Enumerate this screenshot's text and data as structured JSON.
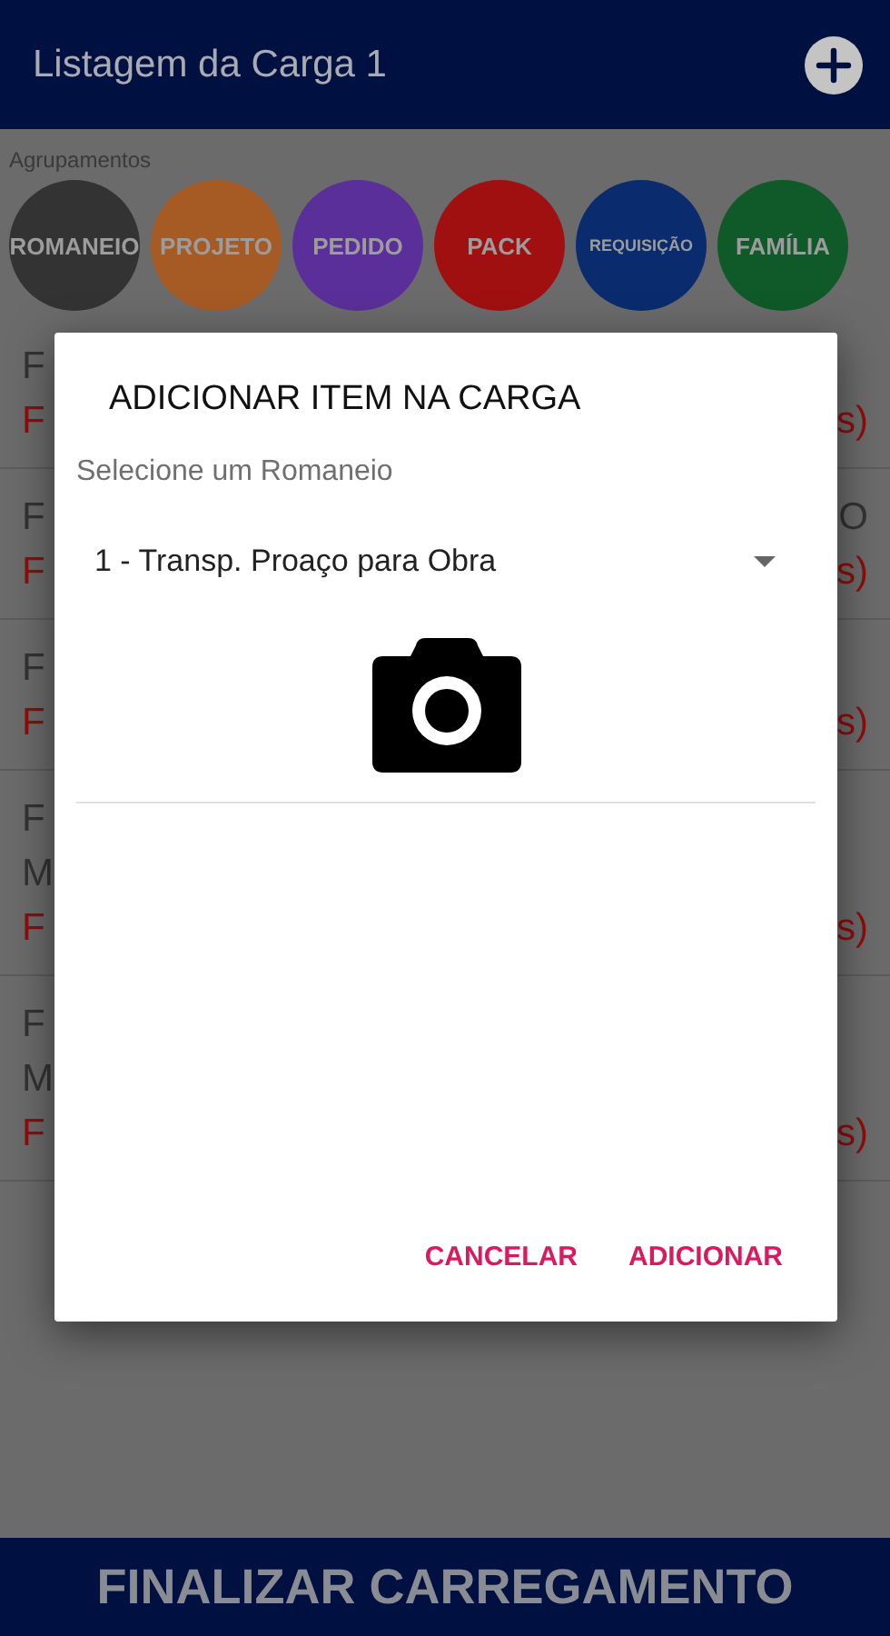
{
  "header": {
    "title": "Listagem da Carga 1"
  },
  "groups": {
    "label": "Agrupamentos",
    "items": [
      {
        "label": "ROMANEIO",
        "color": "#333333"
      },
      {
        "label": "PROJETO",
        "color": "#a65a24"
      },
      {
        "label": "PEDIDO",
        "color": "#5a2f99"
      },
      {
        "label": "PACK",
        "color": "#a01010"
      },
      {
        "label": "REQUISIÇÃO",
        "color": "#0a2c6e"
      },
      {
        "label": "FAMÍLIA",
        "color": "#0f5a28"
      }
    ]
  },
  "rows": [
    {
      "lines": [
        {
          "left": "F",
          "kind": "plain"
        },
        {
          "left": "F",
          "right": "s)",
          "kind": "alert"
        }
      ]
    },
    {
      "lines": [
        {
          "left": "F",
          "right": "O",
          "kind": "plain"
        },
        {
          "left": "F",
          "right": "s)",
          "kind": "alert"
        }
      ]
    },
    {
      "lines": [
        {
          "left": "F",
          "kind": "plain"
        },
        {
          "left": "F",
          "right": "s)",
          "kind": "alert"
        }
      ]
    },
    {
      "lines": [
        {
          "left": "F",
          "kind": "plain"
        },
        {
          "left": "M",
          "kind": "plain"
        },
        {
          "left": "F",
          "right": "s)",
          "kind": "alert"
        }
      ]
    },
    {
      "lines": [
        {
          "left": "F",
          "kind": "plain"
        },
        {
          "left": "M",
          "kind": "plain"
        },
        {
          "left": "F",
          "right": "s)",
          "kind": "alert"
        }
      ]
    }
  ],
  "dialog": {
    "title": "ADICIONAR ITEM NA CARGA",
    "label": "Selecione um Romaneio",
    "select": {
      "value": "1 - Transp. Proaço para Obra"
    },
    "buttons": [
      "CANCELAR",
      "ADICIONAR"
    ]
  },
  "footer": {
    "button": "FINALIZAR CARREGAMENTO"
  }
}
